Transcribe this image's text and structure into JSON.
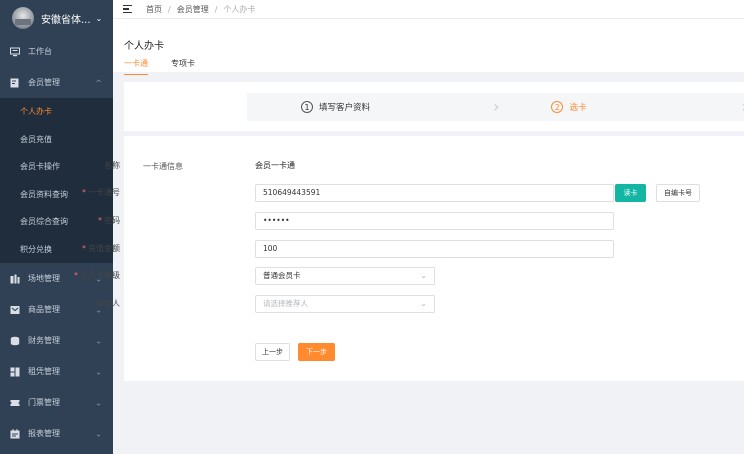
{
  "org": {
    "name": "安徽省体...",
    "caret": "⌄"
  },
  "sidebar": {
    "items": [
      {
        "label": "工作台",
        "icon": "monitor-icon"
      },
      {
        "label": "会员管理",
        "icon": "member-icon",
        "arrow": "^"
      }
    ],
    "submenu": [
      {
        "label": "个人办卡"
      },
      {
        "label": "会员充值"
      },
      {
        "label": "会员卡操作"
      },
      {
        "label": "会员资料查询"
      },
      {
        "label": "会员综合查询"
      },
      {
        "label": "积分兑换"
      }
    ],
    "more": [
      {
        "label": "场地管理",
        "icon": "venue-icon"
      },
      {
        "label": "商品管理",
        "icon": "goods-icon"
      },
      {
        "label": "财务管理",
        "icon": "finance-icon"
      },
      {
        "label": "租凭管理",
        "icon": "rental-icon"
      },
      {
        "label": "门票管理",
        "icon": "ticket-icon"
      },
      {
        "label": "报表管理",
        "icon": "report-icon"
      }
    ],
    "arrow_down": "⌄"
  },
  "breadcrumb": {
    "home": "首页",
    "section": "会员管理",
    "current": "个人办卡",
    "sep": "/"
  },
  "page": {
    "title": "个人办卡"
  },
  "tabs": [
    {
      "label": "一卡通"
    },
    {
      "label": "专项卡"
    }
  ],
  "steps": [
    {
      "num": "1",
      "label": "填写客户资料"
    },
    {
      "num": "2",
      "label": "选卡"
    }
  ],
  "form": {
    "section_title": "一卡通信息",
    "name_label": "名称",
    "name_value": "会员一卡通",
    "card_label": "一卡通号",
    "card_value": "510649443591",
    "read_card_button": "读卡",
    "custom_card_button": "自编卡号",
    "password_label": "密码",
    "password_value": "••••••",
    "amount_label": "充值金额",
    "amount_value": "100",
    "level_label": "会员卡等级",
    "level_value": "普通会员卡",
    "referrer_label": "推荐人",
    "referrer_placeholder": "请选择推荐人",
    "required_mark": "*",
    "prev_button": "上一步",
    "next_button": "下一步"
  },
  "colors": {
    "accent": "#ff8b2e",
    "teal": "#13b5a3",
    "sidebar": "#304156",
    "sidebar_sub": "#1f2d3d"
  }
}
